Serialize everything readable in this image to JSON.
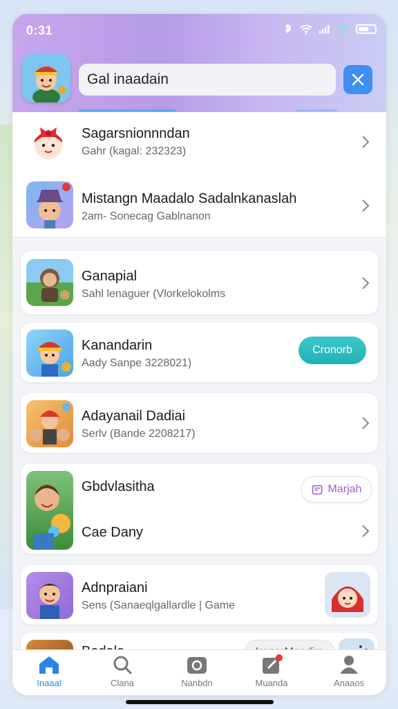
{
  "status_bar": {
    "time": "0:31"
  },
  "search": {
    "value": "Gal inaadain"
  },
  "items": [
    {
      "title": "Sagarsnionnndan",
      "subtitle": "Gahr (kagal: 232323)"
    },
    {
      "title": "Mistangn Maadalo Sadalnkanaslah",
      "subtitle": "2am- Sonecag Gablnanon"
    },
    {
      "title": "Ganapial",
      "subtitle": "Sahl lenaguer (Vlorkelokolms"
    },
    {
      "title": "Kanandarin",
      "subtitle": "Aady Sanpe 3228021)",
      "action": "Cronorb"
    },
    {
      "title": "Adayanail Dadiai",
      "subtitle": "Serlv (Bande 2208217)"
    },
    {
      "title": "Gbdvlasitha",
      "subtitle": "Cae Dany",
      "action": "Marjah"
    },
    {
      "title": "Adnpraiani",
      "subtitle": "Sens (Sanaeqlgallardle | Game"
    },
    {
      "title": "Badala",
      "action": "IranarMandim"
    }
  ],
  "bottom_nav": [
    {
      "label": "Inaaal",
      "icon": "home-icon",
      "active": true
    },
    {
      "label": "Clana",
      "icon": "search-icon",
      "active": false
    },
    {
      "label": "Nanbdn",
      "icon": "camera-icon",
      "active": false
    },
    {
      "label": "Muanda",
      "icon": "edit-icon",
      "active": false,
      "badge": "R"
    },
    {
      "label": "Anaaos",
      "icon": "profile-icon",
      "active": false
    }
  ],
  "colors": {
    "accent": "#3d8ff0",
    "header_start": "#c6a6ec",
    "teal": "#1fb1b8",
    "purple_text": "#a05cc8"
  }
}
